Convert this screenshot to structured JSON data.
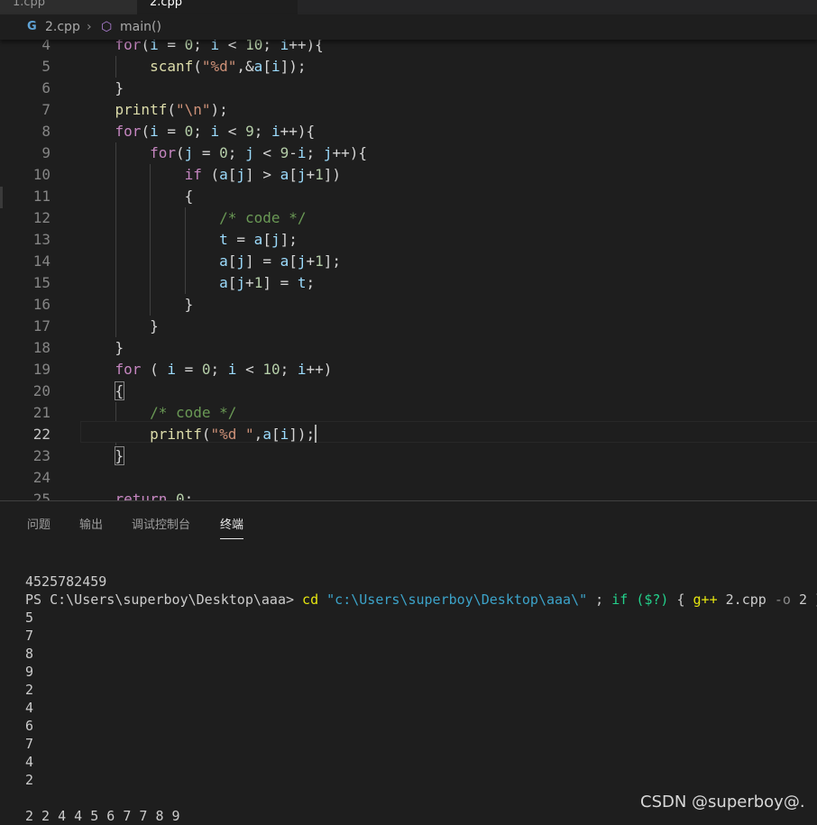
{
  "tabs": [
    {
      "label": "1.cpp"
    },
    {
      "label": "2.cpp"
    }
  ],
  "breadcrumb": {
    "file": "2.cpp",
    "symbol": "main()",
    "file_icon": "cpp-file-icon",
    "symbol_icon": "cube-icon"
  },
  "editor": {
    "active_line": 22,
    "lines": [
      {
        "n": "4",
        "indent": 1
      },
      {
        "n": "5",
        "indent": 2
      },
      {
        "n": "6",
        "indent": 1
      },
      {
        "n": "7",
        "indent": 1
      },
      {
        "n": "8",
        "indent": 1
      },
      {
        "n": "9",
        "indent": 2
      },
      {
        "n": "10",
        "indent": 3
      },
      {
        "n": "11",
        "indent": 3
      },
      {
        "n": "12",
        "indent": 4
      },
      {
        "n": "13",
        "indent": 4
      },
      {
        "n": "14",
        "indent": 4
      },
      {
        "n": "15",
        "indent": 4
      },
      {
        "n": "16",
        "indent": 3
      },
      {
        "n": "17",
        "indent": 2
      },
      {
        "n": "18",
        "indent": 1
      },
      {
        "n": "19",
        "indent": 1
      },
      {
        "n": "20",
        "indent": 1
      },
      {
        "n": "21",
        "indent": 2
      },
      {
        "n": "22",
        "indent": 2
      },
      {
        "n": "23",
        "indent": 1
      },
      {
        "n": "24",
        "indent": 0
      },
      {
        "n": "25",
        "indent": 1
      }
    ]
  },
  "panel": {
    "tabs": [
      "问题",
      "输出",
      "调试控制台",
      "终端"
    ],
    "active_tab": "终端"
  },
  "terminal": {
    "input_echo": "4525782459",
    "prompt": "PS C:\\Users\\superboy\\Desktop\\aaa>",
    "cmd": "cd",
    "path_arg": "\"c:\\Users\\superboy\\Desktop\\aaa\\\"",
    "sep": ";",
    "if_kw": "if",
    "cond": "($?)",
    "brace_open": "{",
    "gpp": "g++",
    "file": "2.cpp",
    "flag": "-o",
    "out": "2",
    "brace_close": "}",
    "outputs": [
      "5",
      "7",
      "8",
      "9",
      "2",
      "4",
      "6",
      "7",
      "4",
      "2"
    ],
    "result": "2 2 4 4 5 6 7 7 8 9"
  },
  "watermark": "CSDN @superboy@."
}
